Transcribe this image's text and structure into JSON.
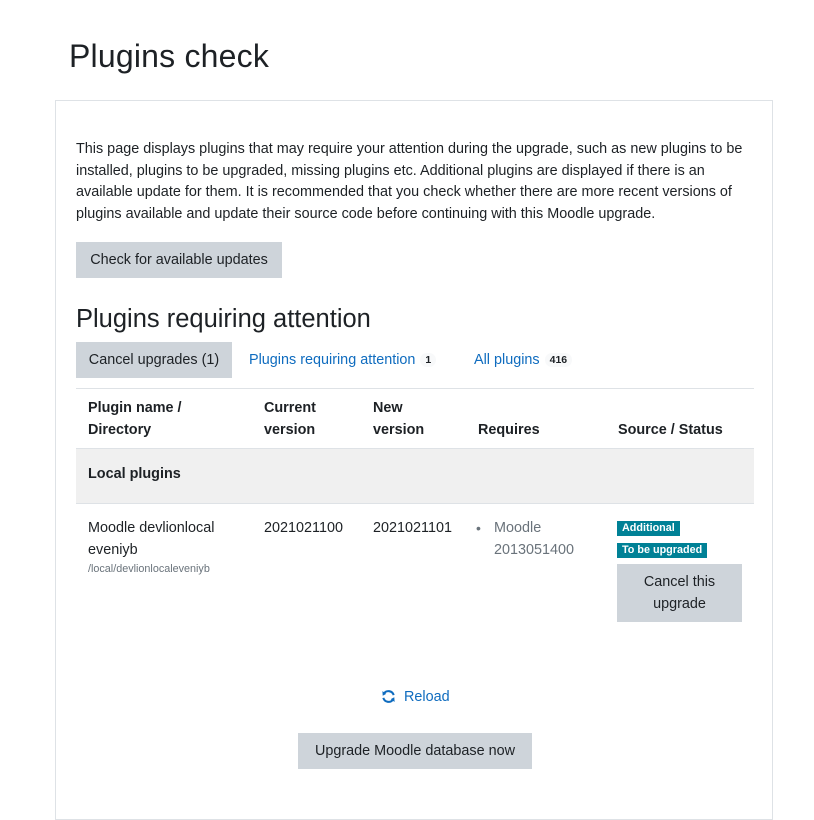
{
  "page": {
    "title": "Plugins check"
  },
  "intro": "This page displays plugins that may require your attention during the upgrade, such as new plugins to be installed, plugins to be upgraded, missing plugins etc. Additional plugins are displayed if there is an available update for them. It is recommended that you check whether there are more recent versions of plugins available and update their source code before continuing with this Moodle upgrade.",
  "buttons": {
    "check_updates": "Check for available updates",
    "upgrade_db": "Upgrade Moodle database now"
  },
  "section_title": "Plugins requiring attention",
  "tabs": [
    {
      "label": "Cancel upgrades (1)",
      "active": true
    },
    {
      "label": "Plugins requiring attention",
      "count": "1"
    },
    {
      "label": "All plugins",
      "count": "416"
    }
  ],
  "table": {
    "headers": {
      "plugin_name_line1": "Plugin name /",
      "plugin_name_line2": "Directory",
      "current_line1": "Current",
      "current_line2": "version",
      "new_line1": "New",
      "new_line2": "version",
      "requires": "Requires",
      "source_status": "Source / Status"
    },
    "group": "Local plugins",
    "rows": [
      {
        "name_line1": "Moodle devlionlocal",
        "name_line2": "eveniyb",
        "directory": "/local/devlionlocaleveniyb",
        "current_version": "2021021100",
        "new_version": "2021021101",
        "requires_line1": "Moodle",
        "requires_line2": "2013051400",
        "badges": [
          "Additional",
          "To be upgraded"
        ],
        "action": "Cancel this upgrade"
      }
    ]
  },
  "reload": {
    "label": "Reload",
    "icon": "refresh-icon"
  },
  "colors": {
    "link": "#0f6cbf",
    "badge": "#008196",
    "button": "#ced4da"
  }
}
